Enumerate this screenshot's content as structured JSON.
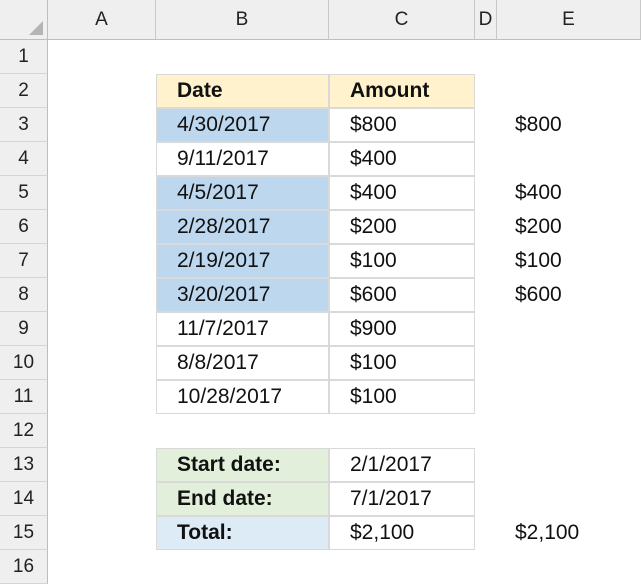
{
  "columns": [
    "A",
    "B",
    "C",
    "D",
    "E"
  ],
  "rows": [
    "1",
    "2",
    "3",
    "4",
    "5",
    "6",
    "7",
    "8",
    "9",
    "10",
    "11",
    "12",
    "13",
    "14",
    "15",
    "16"
  ],
  "table": {
    "headers": {
      "date": "Date",
      "amount": "Amount"
    },
    "rows": [
      {
        "date": "4/30/2017",
        "amount": "$800",
        "e": "$800",
        "highlight": true
      },
      {
        "date": "9/11/2017",
        "amount": "$400",
        "e": "",
        "highlight": false
      },
      {
        "date": "4/5/2017",
        "amount": "$400",
        "e": "$400",
        "highlight": true
      },
      {
        "date": "2/28/2017",
        "amount": "$200",
        "e": "$200",
        "highlight": true
      },
      {
        "date": "2/19/2017",
        "amount": "$100",
        "e": "$100",
        "highlight": true
      },
      {
        "date": "3/20/2017",
        "amount": "$600",
        "e": "$600",
        "highlight": true
      },
      {
        "date": "11/7/2017",
        "amount": "$900",
        "e": "",
        "highlight": false
      },
      {
        "date": "8/8/2017",
        "amount": "$100",
        "e": "",
        "highlight": false
      },
      {
        "date": "10/28/2017",
        "amount": "$100",
        "e": "",
        "highlight": false
      }
    ]
  },
  "criteria": {
    "start_label": "Start date:",
    "start_value": "2/1/2017",
    "end_label": "End date:",
    "end_value": "7/1/2017",
    "total_label": "Total:",
    "total_value": "$2,100",
    "total_e": "$2,100"
  },
  "colors": {
    "header": "#fff2cc",
    "highlight": "#bdd7ee",
    "criteria": "#e2efda",
    "total": "#ddebf7"
  }
}
